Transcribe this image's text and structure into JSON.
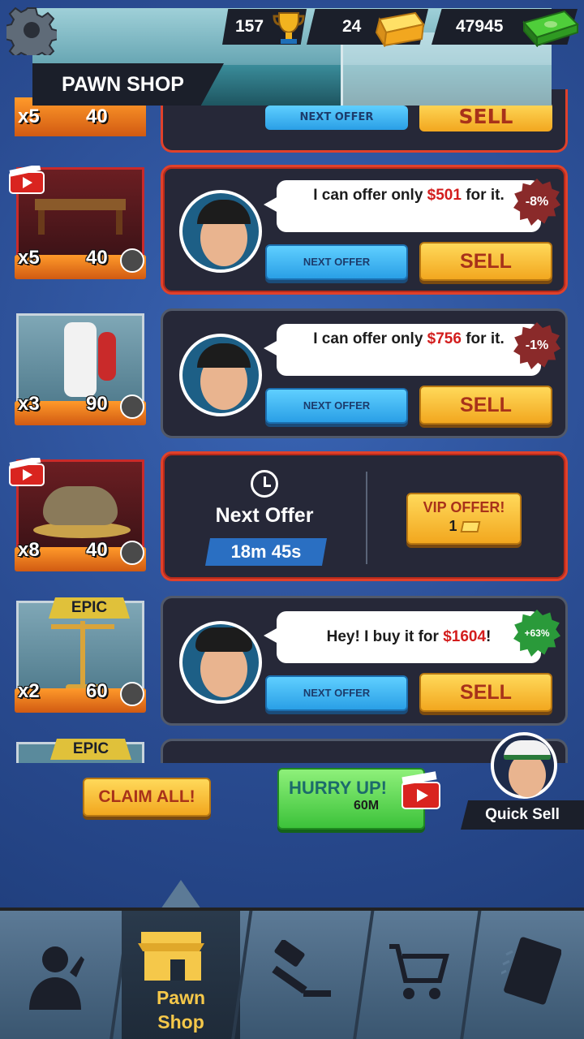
{
  "header": {
    "title": "PAWN SHOP",
    "trophies": "157",
    "gold": "24",
    "cash": "47945"
  },
  "items": [
    {
      "qty": "x5",
      "price": "40",
      "video": true
    },
    {
      "qty": "x3",
      "price": "90"
    },
    {
      "qty": "x8",
      "price": "40",
      "video": true
    },
    {
      "qty": "x2",
      "price": "60",
      "badge": "EPIC"
    }
  ],
  "offers": [
    {
      "text_pre": "I can offer only ",
      "amount": "$501",
      "text_post": " for it.",
      "tag": "-8%",
      "next_label": "NEXT OFFER",
      "sell_label": "SELL"
    },
    {
      "text_pre": "I can offer only ",
      "amount": "$756",
      "text_post": " for it.",
      "tag": "-1%",
      "next_label": "NEXT OFFER",
      "sell_label": "SELL"
    },
    {
      "next_offer_title": "Next Offer",
      "timer": "18m 45s",
      "vip_label": "VIP OFFER!",
      "vip_cost": "1"
    },
    {
      "text_pre": "Hey! I buy it for ",
      "amount": "$1604",
      "text_post": "!",
      "tag": "+63%",
      "next_label": "NEXT OFFER",
      "sell_label": "SELL"
    }
  ],
  "partial_top": {
    "qty": "x5",
    "price": "40",
    "next_label": "NEXT OFFER",
    "sell_label": "SELL"
  },
  "partial_bottom_badge": "EPIC",
  "actions": {
    "claim_all": "CLAIM ALL!",
    "hurry_up": "HURRY UP!",
    "hurry_amount": "60M",
    "quick_sell": "Quick Sell"
  },
  "nav": {
    "tabs": [
      {
        "icon": "person-icon"
      },
      {
        "icon": "shop-icon",
        "label_line1": "Pawn",
        "label_line2": "Shop",
        "active": true
      },
      {
        "icon": "gavel-icon"
      },
      {
        "icon": "cart-icon"
      },
      {
        "icon": "notebook-icon"
      }
    ]
  }
}
